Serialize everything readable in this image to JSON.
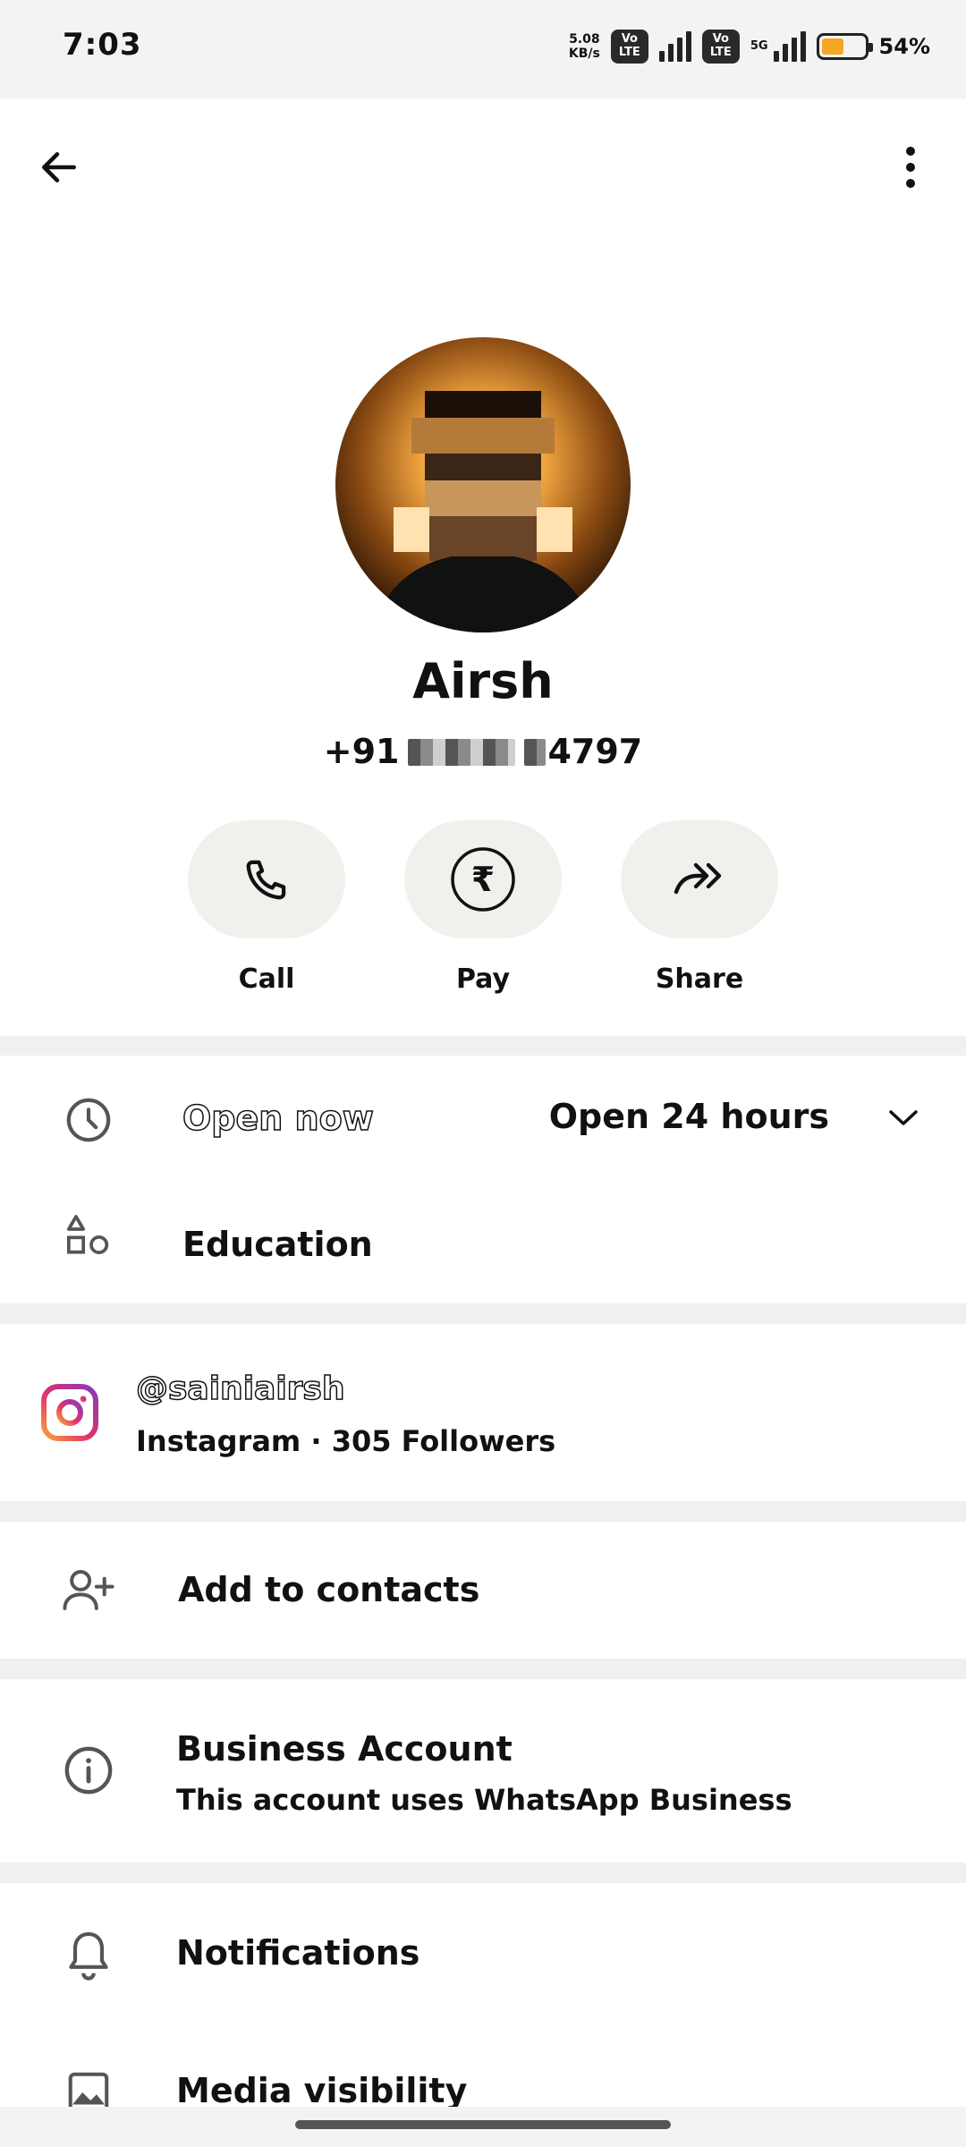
{
  "status_bar": {
    "time": "7:03",
    "net_speed_value": "5.08",
    "net_speed_unit": "KB/s",
    "volte1": "Vo LTE",
    "volte2": "Vo LTE",
    "network_type": "5G",
    "battery_percent": "54%",
    "battery_level": 0.54,
    "battery_color": "#f5a623"
  },
  "header": {
    "back_icon": "arrow-left-icon",
    "menu_icon": "more-vertical-icon"
  },
  "profile": {
    "name": "Airsh",
    "phone_prefix": "+91",
    "phone_suffix": "4797"
  },
  "actions": [
    {
      "label": "Call",
      "icon": "phone-icon"
    },
    {
      "label": "Pay",
      "icon": "rupee-icon"
    },
    {
      "label": "Share",
      "icon": "share-forward-icon"
    }
  ],
  "business_hours": {
    "status": "Open now",
    "hours": "Open 24 hours",
    "category": "Education"
  },
  "instagram": {
    "handle": "@sainiairsh",
    "detail": "Instagram · 305 Followers",
    "icon": "instagram-icon"
  },
  "add_contact": {
    "label": "Add to contacts",
    "icon": "add-person-icon"
  },
  "business_account": {
    "title": "Business Account",
    "subtitle": "This account uses WhatsApp Business",
    "icon": "info-icon"
  },
  "notifications": {
    "label": "Notifications",
    "icon": "bell-icon"
  },
  "media_visibility": {
    "label": "Media visibility",
    "icon": "image-icon"
  }
}
